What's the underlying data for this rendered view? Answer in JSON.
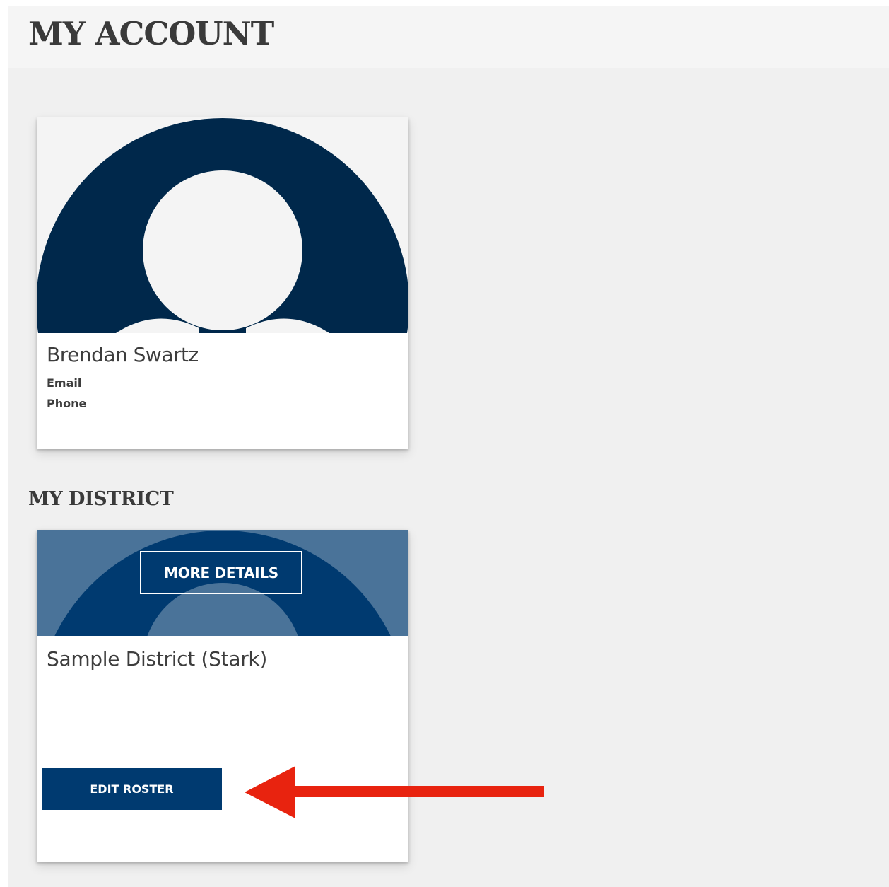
{
  "header": {
    "title": "MY ACCOUNT"
  },
  "profile": {
    "name": "Brendan Swartz",
    "email_label": "Email",
    "phone_label": "Phone",
    "avatar_icon": "user-avatar-placeholder-icon"
  },
  "district_section": {
    "title": "MY DISTRICT",
    "district": {
      "name": "Sample District (Stark)",
      "more_details_label": "MORE DETAILS",
      "edit_roster_label": "EDIT ROSTER"
    }
  },
  "annotation": {
    "icon": "red-arrow-pointing-left-icon",
    "color": "#e8230f"
  },
  "colors": {
    "navy": "#00284b",
    "button_navy": "#003a70",
    "steel_blue": "#4a7399",
    "page_bg": "#f0f0f0"
  }
}
